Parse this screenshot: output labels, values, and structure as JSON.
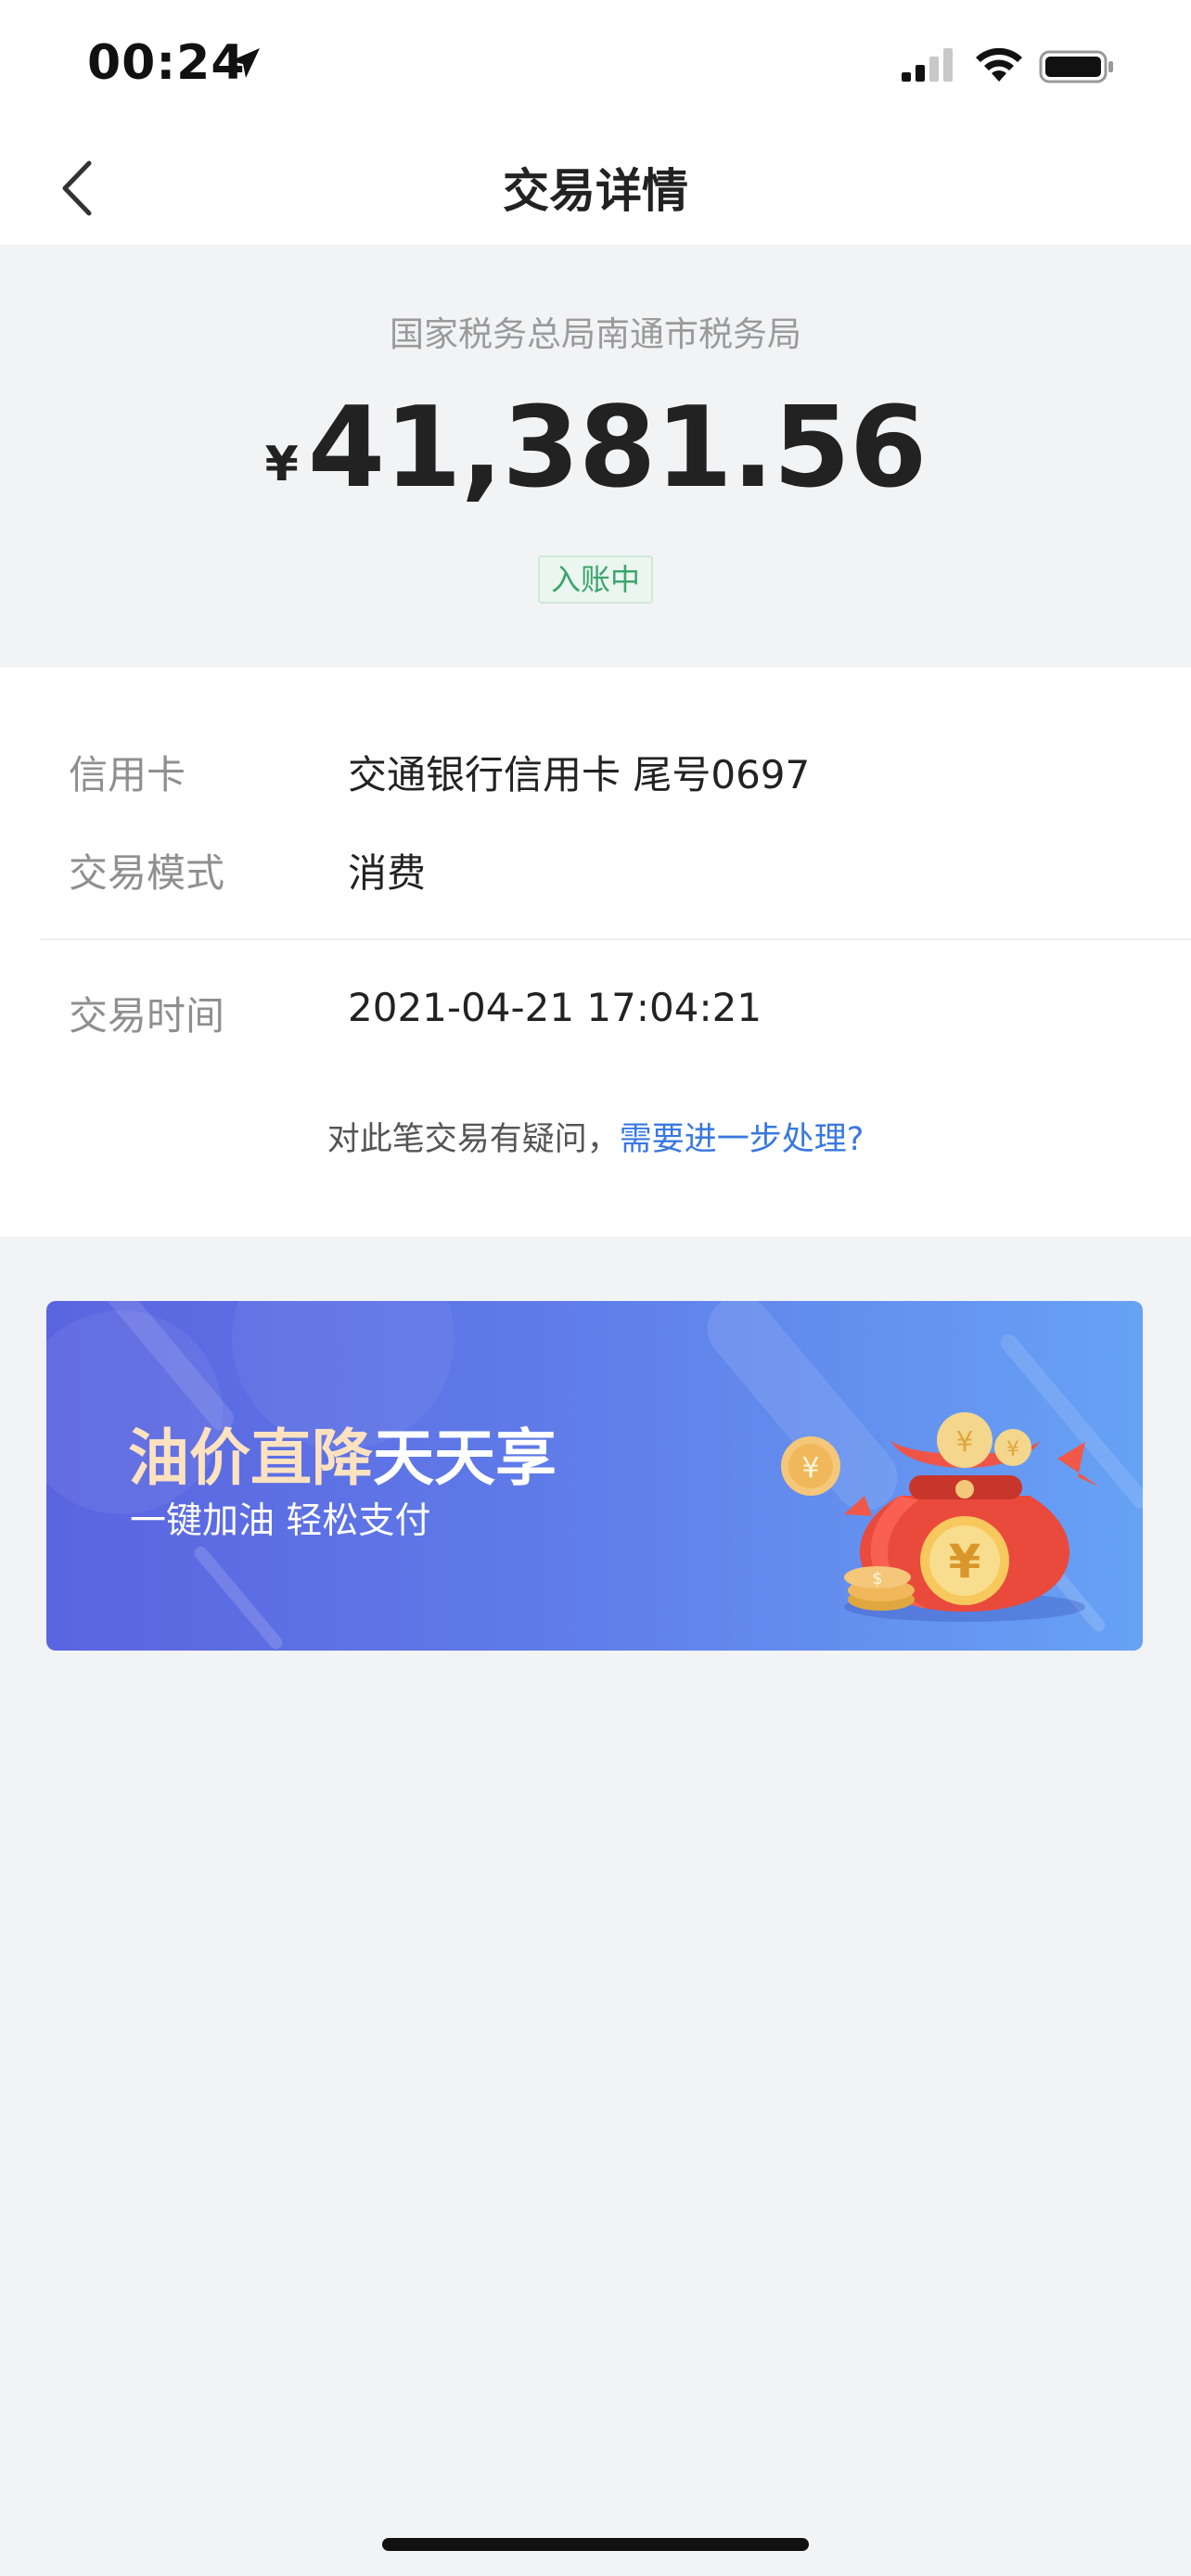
{
  "status_bar": {
    "time": "00:24"
  },
  "nav": {
    "title": "交易详情"
  },
  "summary": {
    "merchant": "国家税务总局南通市税务局",
    "currency_symbol": "¥",
    "amount": "41,381.56",
    "status": "入账中"
  },
  "details": {
    "rows": [
      {
        "label": "信用卡",
        "value": "交通银行信用卡 尾号0697"
      },
      {
        "label": "交易模式",
        "value": "消费"
      },
      {
        "label": "交易时间",
        "value": "2021-04-21 17:04:21"
      }
    ],
    "help_text": "对此笔交易有疑问，",
    "help_link": "需要进一步处理?"
  },
  "banner": {
    "title_highlight": "油价直降",
    "title_rest": "天天享",
    "subtitle": "一键加油 轻松支付"
  },
  "colors": {
    "background": "#f2f3f5",
    "status_green": "#3aa56b",
    "link_blue": "#3a78e0",
    "banner_start": "#5b64e0",
    "banner_end": "#67a2f5"
  },
  "icons": [
    "location-arrow-icon",
    "signal-icon",
    "wifi-icon",
    "battery-icon",
    "back-icon",
    "moneybag-icon"
  ]
}
